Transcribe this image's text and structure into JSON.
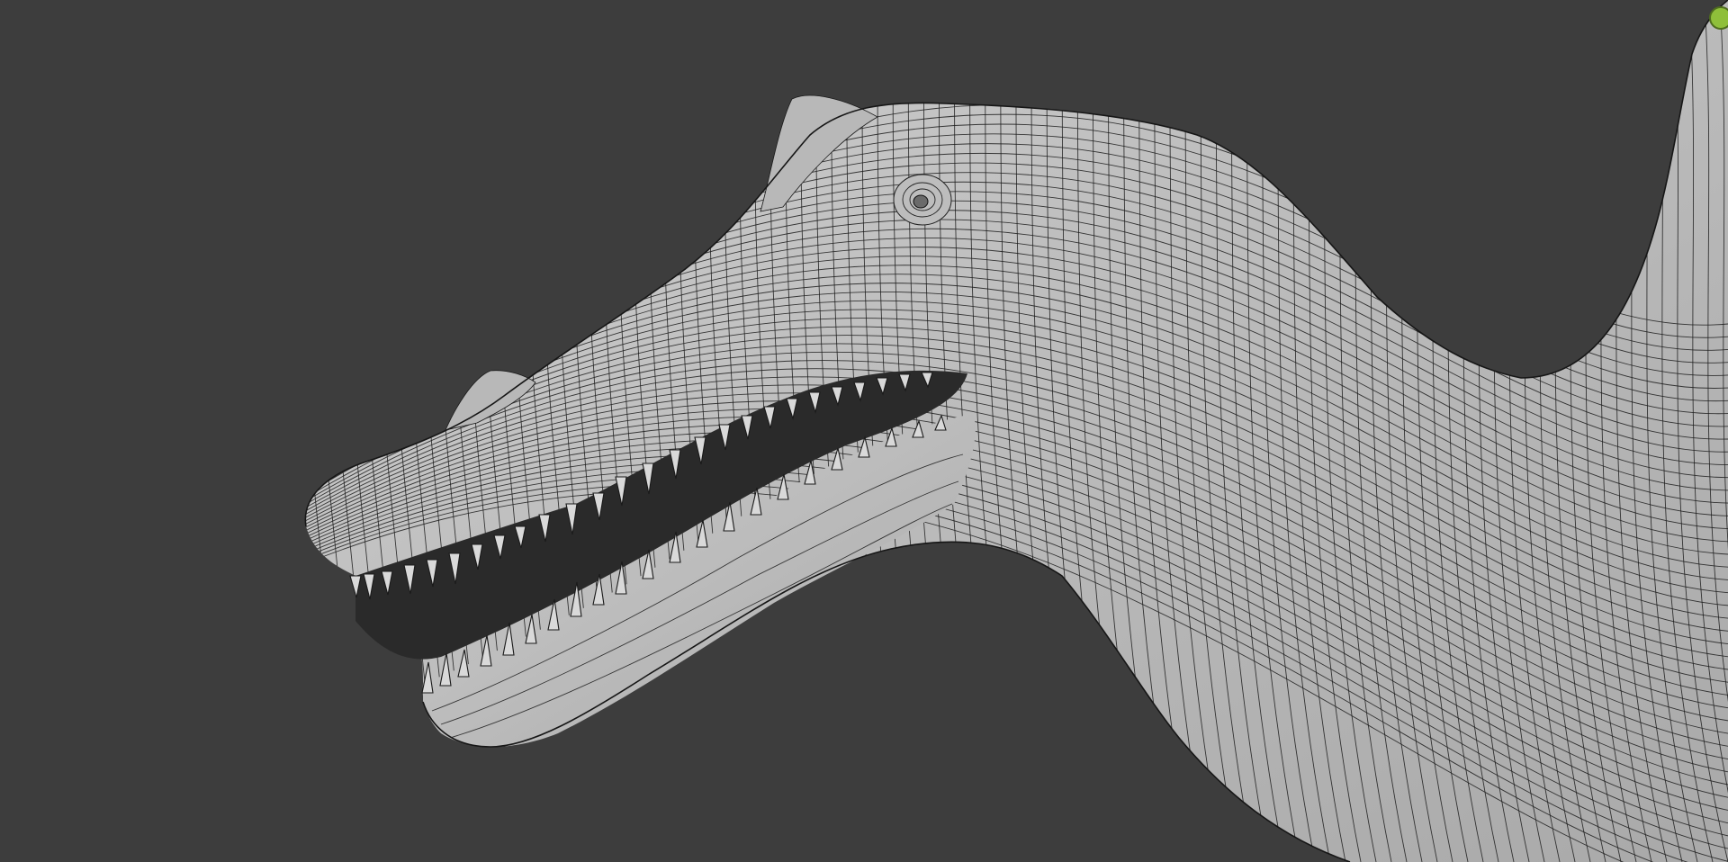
{
  "viewport": {
    "background": "#3d3d3d",
    "mesh_color": "#c4c4c4",
    "wire_color": "#1c1c1c",
    "indicator_color": "#8fbf3a"
  },
  "scene": {
    "object": "wireframe-creature-head",
    "overlay": "wireframe",
    "shading": "solid"
  },
  "icons": {
    "corner_indicator": "green-dot-icon"
  }
}
